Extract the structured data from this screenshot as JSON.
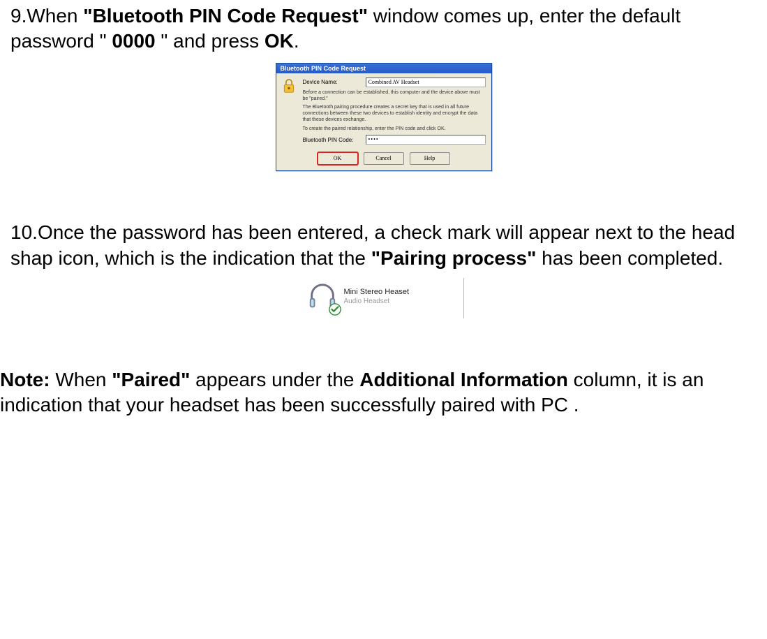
{
  "step9": {
    "num": "9.",
    "text_a": "When ",
    "bold_a": "\"Bluetooth PIN Code Request\"",
    "text_b": " window comes up, enter the default password \" ",
    "bold_b": "0000",
    "text_c": " \" and press ",
    "bold_c": "OK",
    "text_d": "."
  },
  "dialog": {
    "title": "Bluetooth PIN Code Request",
    "device_name_label": "Device Name:",
    "device_name_value": "Combined AV Headset",
    "msg1": "Before a connection can be established, this computer and the device above must be \"paired.\"",
    "msg2": "The Bluetooth pairing procedure creates a secret key that is used in all future connections between these two devices to establish identity and encrypt the data that these devices exchange.",
    "msg3": "To create the paired relationship, enter the PIN code and click OK.",
    "pin_label": "Bluetooth PIN Code:",
    "pin_value": "••••",
    "ok": "OK",
    "cancel": "Cancel",
    "help": "Help"
  },
  "step10": {
    "num": "10.",
    "text_a": "Once the password has been entered, a check mark will appear next to the head shap icon, which is the indication that the ",
    "bold_a": "\"Pairing process\"",
    "text_b": " has been completed."
  },
  "paired_fig": {
    "line1": "Mini Stereo Heaset",
    "line2": "Audio Headset"
  },
  "note": {
    "label": "Note:",
    "text_a": " When ",
    "bold_a": "\"Paired\"",
    "text_b": " appears under the ",
    "bold_b": "Additional Information",
    "text_c": " column, it is an indication that your headset has been successfully paired with PC ."
  }
}
